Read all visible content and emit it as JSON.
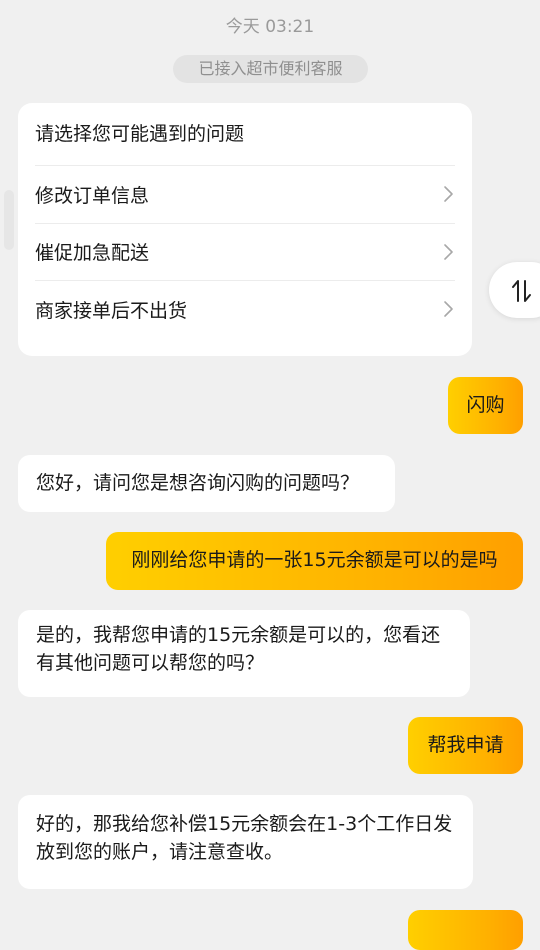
{
  "timestamp": "今天 03:21",
  "system_notice": "已接入超市便利客服",
  "menu": {
    "title": "请选择您可能遇到的问题",
    "items": [
      {
        "label": "修改订单信息"
      },
      {
        "label": "催促加急配送"
      },
      {
        "label": "商家接单后不出货"
      }
    ]
  },
  "icons": {
    "chevron": "chevron-right-icon",
    "swap": "swap-vertical-icon"
  },
  "colors": {
    "background": "#f0f0f0",
    "incoming_bubble": "#ffffff",
    "outgoing_gradient_start": "#ffcf00",
    "outgoing_gradient_end": "#ff9f00"
  },
  "messages": [
    {
      "sender": "user",
      "text": "闪购"
    },
    {
      "sender": "agent",
      "text": "您好，请问您是想咨询闪购的问题吗？"
    },
    {
      "sender": "user",
      "text": "刚刚给您申请的一张15元余额是可以的是吗"
    },
    {
      "sender": "agent",
      "text": "是的，我帮您申请的15元余额是可以的，您看还有其他问题可以帮您的吗？"
    },
    {
      "sender": "user",
      "text": "帮我申请"
    },
    {
      "sender": "agent",
      "text": "好的，那我给您补偿15元余额会在1-3个工作日发放到您的账户，请注意查收。"
    },
    {
      "sender": "user",
      "text": ""
    }
  ]
}
